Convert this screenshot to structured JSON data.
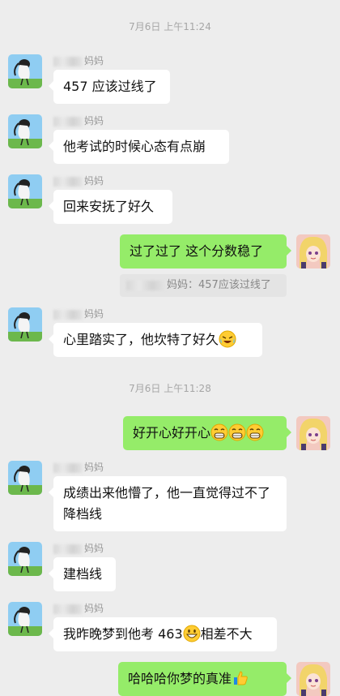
{
  "timestamps": [
    "7月6日 上午11:24",
    "7月6日 上午11:28"
  ],
  "sender_suffix": "妈妈",
  "quote": {
    "suffix": "妈妈：457应该过线了"
  },
  "messages": [
    {
      "text": "457 应该过线了"
    },
    {
      "text": "他考试的时候心态有点崩"
    },
    {
      "text": "回来安抚了好久"
    },
    {
      "text": "过了过了 这个分数稳了"
    },
    {
      "text": "心里踏实了，他坎特了好久"
    },
    {
      "text": "好开心好开心"
    },
    {
      "text": "成绩出来他懵了，他一直觉得过不了降档线"
    },
    {
      "text": "建档线"
    },
    {
      "text_before": "我昨晚梦到他考 463",
      "text_after": "相差不大"
    },
    {
      "text": "哈哈哈你梦的真准"
    }
  ],
  "icons": {
    "contact_avatar": "contact-avatar-girl-icon",
    "own_avatar": "own-avatar-anime-icon",
    "emojis": [
      "laugh-crying-emoji",
      "grin-emoji",
      "grinning-emoji",
      "thumbs-up-emoji"
    ]
  }
}
